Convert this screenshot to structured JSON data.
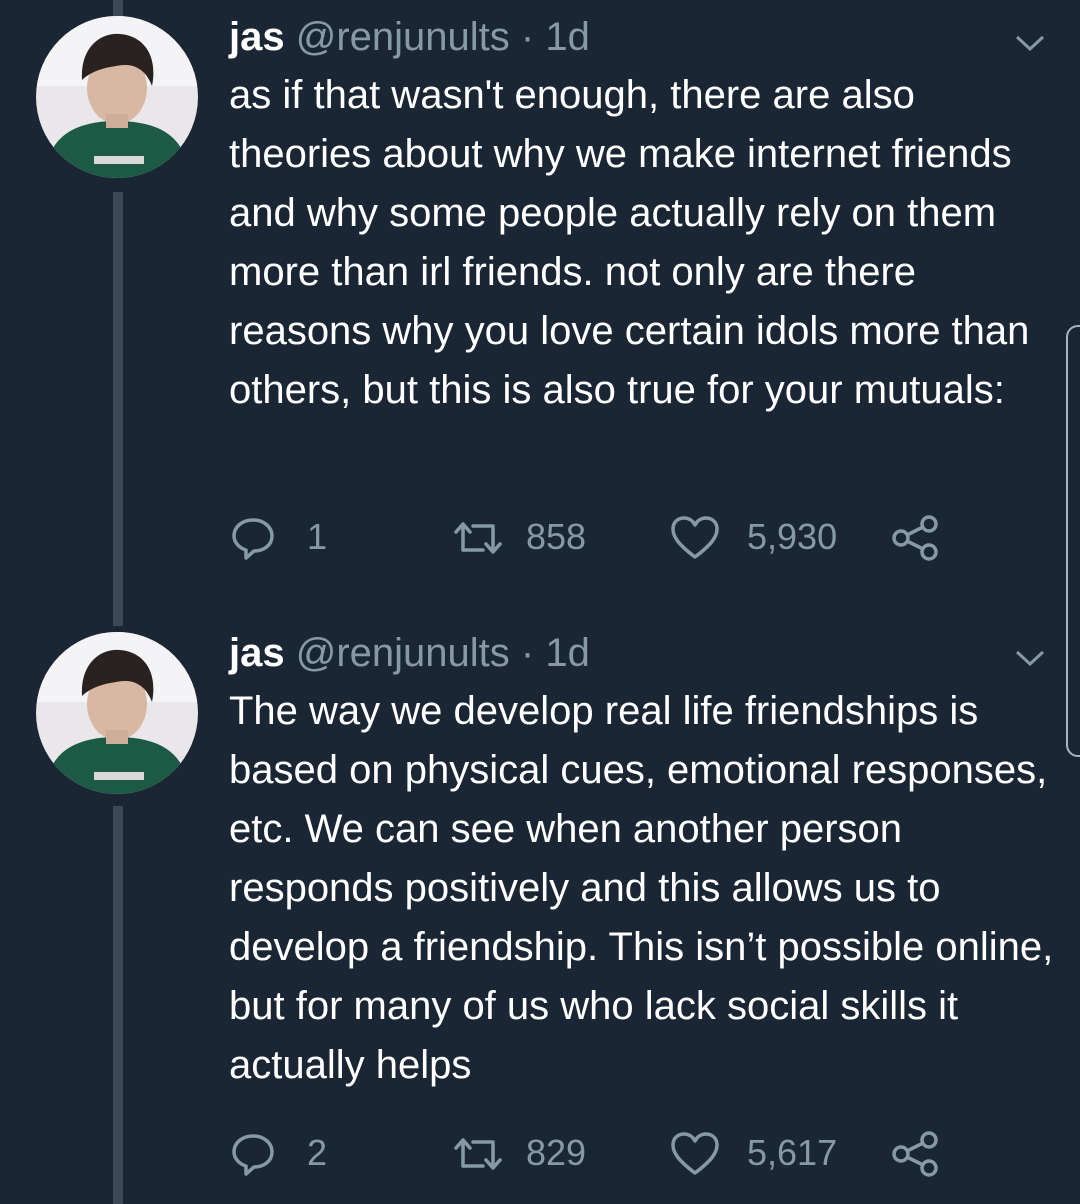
{
  "tweets": [
    {
      "name": "jas",
      "handle": "@renjunults",
      "separator": "·",
      "time": "1d",
      "text": "as if that wasn't enough, there are also theories about why we make internet friends and why some people actually rely on them more than irl friends. not only are there reasons why you love certain idols more than others, but this is also true for your mutuals:",
      "replies": "1",
      "retweets": "858",
      "likes": "5,930"
    },
    {
      "name": "jas",
      "handle": "@renjunults",
      "separator": "·",
      "time": "1d",
      "text": "The way we develop real life friendships is based on physical cues, emotional responses, etc. We can see when another person responds positively and this allows us to develop a friendship. This isn’t possible online, but for many of us who lack social skills it actually helps",
      "replies": "2",
      "retweets": "829",
      "likes": "5,617"
    }
  ],
  "icons": {
    "reply": "reply-icon",
    "retweet": "retweet-icon",
    "like": "heart-icon",
    "share": "share-icon",
    "menu": "chevron-down-icon"
  },
  "colors": {
    "background": "#1b2634",
    "text": "#ffffff",
    "muted": "#8899a6",
    "thread_line": "#3c4855"
  }
}
